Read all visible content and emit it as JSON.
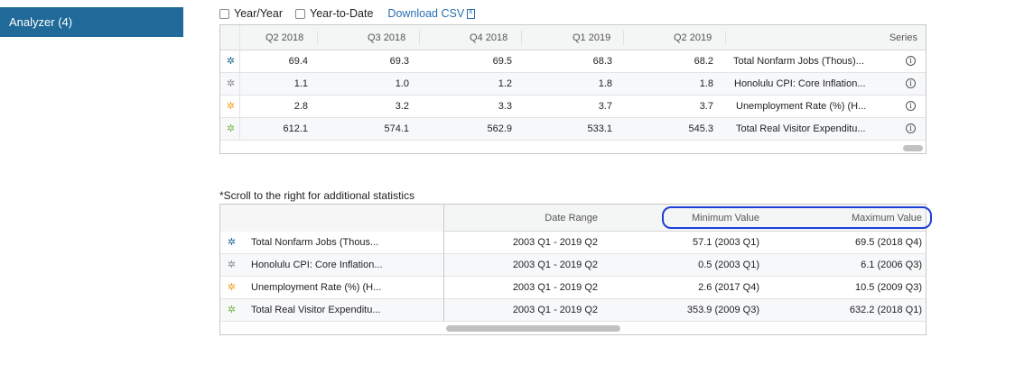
{
  "sidebar": {
    "tab_label": "Analyzer (4)"
  },
  "toolbar": {
    "yoy_label": "Year/Year",
    "ytd_label": "Year-to-Date",
    "download_label": "Download CSV"
  },
  "colors": {
    "accent": "#1f6a98",
    "link": "#2a6fb0",
    "highlight": "#1d3fd8"
  },
  "series_icons": [
    {
      "icon": "gear-icon",
      "color": "#1f6a98"
    },
    {
      "icon": "gear-icon",
      "color": "#8c8c8c"
    },
    {
      "icon": "gear-icon",
      "color": "#f0a020"
    },
    {
      "icon": "gear-icon",
      "color": "#7ab648"
    }
  ],
  "table1": {
    "headers": [
      "Q2 2018",
      "Q3 2018",
      "Q4 2018",
      "Q1 2019",
      "Q2 2019",
      "Series"
    ],
    "rows": [
      {
        "values": [
          "69.4",
          "69.3",
          "69.5",
          "68.3",
          "68.2"
        ],
        "series": "Total Nonfarm Jobs (Thous)..."
      },
      {
        "values": [
          "1.1",
          "1.0",
          "1.2",
          "1.8",
          "1.8"
        ],
        "series": "Honolulu CPI: Core Inflation..."
      },
      {
        "values": [
          "2.8",
          "3.2",
          "3.3",
          "3.7",
          "3.7"
        ],
        "series": "Unemployment Rate (%) (H..."
      },
      {
        "values": [
          "612.1",
          "574.1",
          "562.9",
          "533.1",
          "545.3"
        ],
        "series": "Total Real Visitor Expenditu..."
      }
    ]
  },
  "note": "*Scroll to the right for additional statistics",
  "table2": {
    "headers": {
      "date_range": "Date Range",
      "min": "Minimum Value",
      "max": "Maximum Value"
    },
    "rows": [
      {
        "series": "Total Nonfarm Jobs (Thous...",
        "range": "2003 Q1 - 2019 Q2",
        "min": "57.1 (2003 Q1)",
        "max": "69.5 (2018 Q4)"
      },
      {
        "series": "Honolulu CPI: Core Inflation...",
        "range": "2003 Q1 - 2019 Q2",
        "min": "0.5 (2003 Q1)",
        "max": "6.1 (2006 Q3)"
      },
      {
        "series": "Unemployment Rate (%) (H...",
        "range": "2003 Q1 - 2019 Q2",
        "min": "2.6 (2017 Q4)",
        "max": "10.5 (2009 Q3)"
      },
      {
        "series": "Total Real Visitor Expenditu...",
        "range": "2003 Q1 - 2019 Q2",
        "min": "353.9 (2009 Q3)",
        "max": "632.2 (2018 Q1)"
      }
    ]
  }
}
